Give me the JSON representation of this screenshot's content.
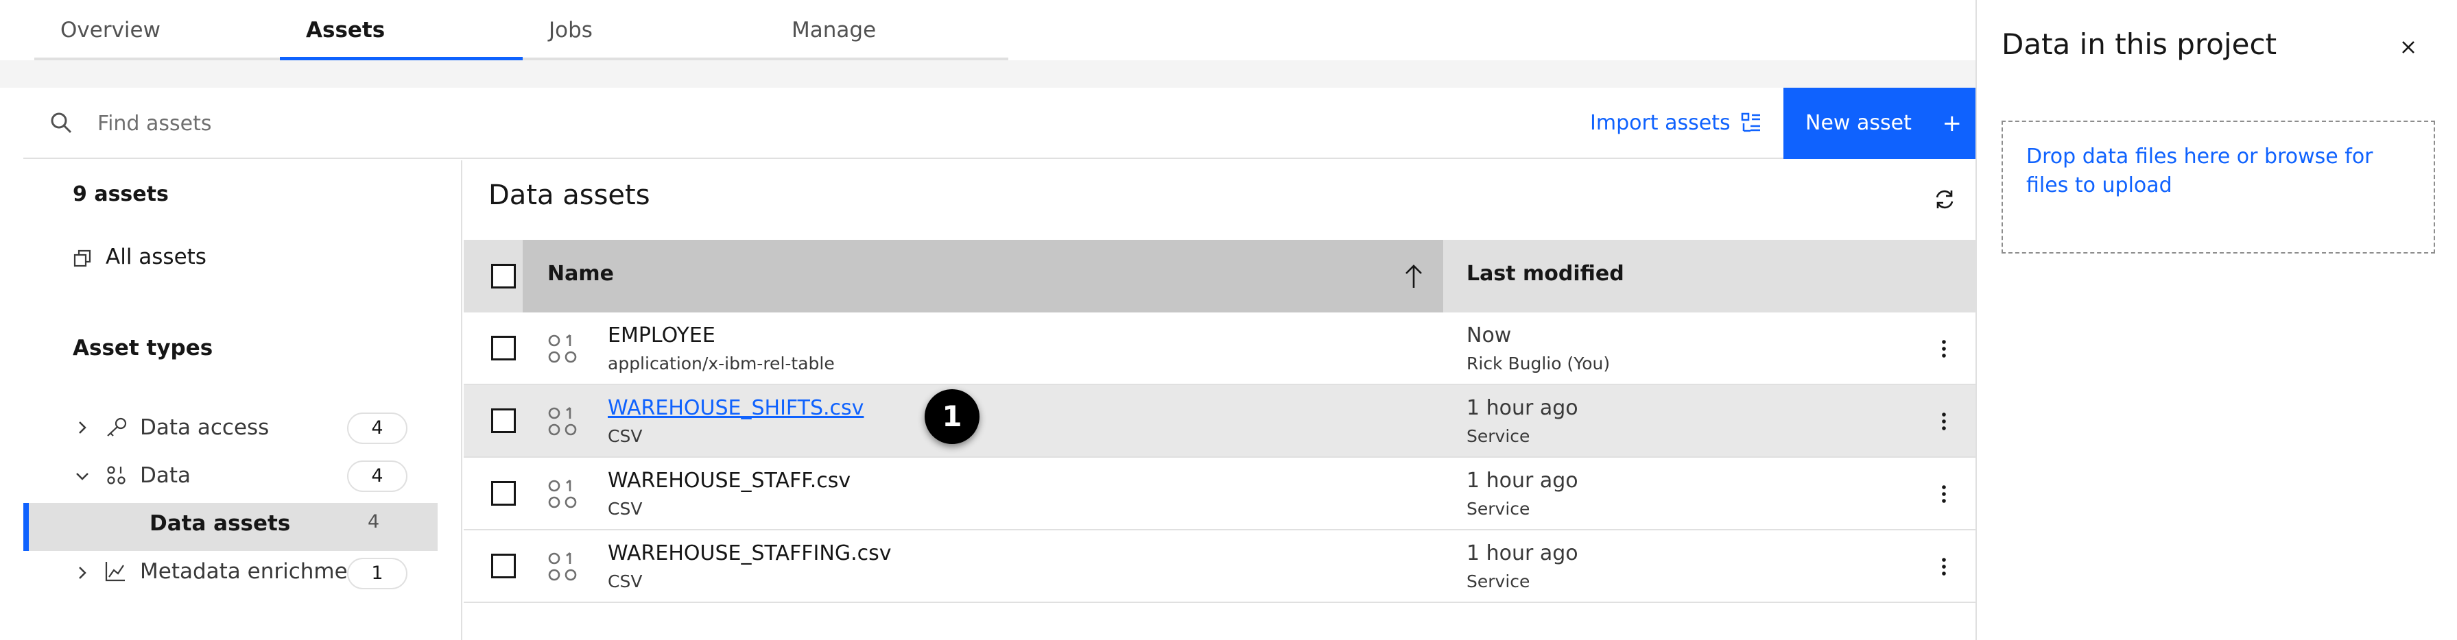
{
  "tabs": [
    {
      "label": "Overview"
    },
    {
      "label": "Assets"
    },
    {
      "label": "Jobs"
    },
    {
      "label": "Manage"
    }
  ],
  "toolbar": {
    "search_placeholder": "Find assets",
    "import_label": "Import assets",
    "new_asset_label": "New asset",
    "new_asset_plus": "+"
  },
  "sidebar": {
    "count_label": "9 assets",
    "all_assets_label": "All assets",
    "asset_types_heading": "Asset types",
    "items": [
      {
        "label": "Data access",
        "count": "4",
        "expanded": false
      },
      {
        "label": "Data",
        "count": "4",
        "expanded": true
      },
      {
        "label": "Data assets",
        "count": "4",
        "selected": true
      },
      {
        "label": "Metadata enrichment",
        "count": "1",
        "expanded": false
      }
    ]
  },
  "table": {
    "title": "Data assets",
    "columns": {
      "name": "Name",
      "last_modified": "Last modified"
    },
    "sort": "ascending",
    "rows": [
      {
        "name": "EMPLOYEE",
        "type": "application/x-ibm-rel-table",
        "when": "Now",
        "who": "Rick Buglio (You)",
        "link": false,
        "highlighted": false
      },
      {
        "name": "WAREHOUSE_SHIFTS.csv",
        "type": "CSV",
        "when": "1 hour ago",
        "who": "Service",
        "link": true,
        "highlighted": true
      },
      {
        "name": "WAREHOUSE_STAFF.csv",
        "type": "CSV",
        "when": "1 hour ago",
        "who": "Service",
        "link": false,
        "highlighted": false
      },
      {
        "name": "WAREHOUSE_STAFFING.csv",
        "type": "CSV",
        "when": "1 hour ago",
        "who": "Service",
        "link": false,
        "highlighted": false
      }
    ]
  },
  "callout": {
    "label": "1"
  },
  "panel": {
    "title": "Data in this project",
    "drop_text": "Drop data files here or browse for files to upload"
  },
  "colors": {
    "accent": "#0f62fe",
    "header_bg": "#e0e0e0",
    "highlight_row": "#e8e8e8"
  },
  "icons": [
    "search-icon",
    "import-icon",
    "plus-icon",
    "all-assets-icon",
    "key-icon",
    "data-icon",
    "chart-icon",
    "chevron-right-icon",
    "chevron-down-icon",
    "refresh-icon",
    "sort-arrow-up-icon",
    "data-asset-icon",
    "overflow-menu-icon",
    "close-icon"
  ]
}
